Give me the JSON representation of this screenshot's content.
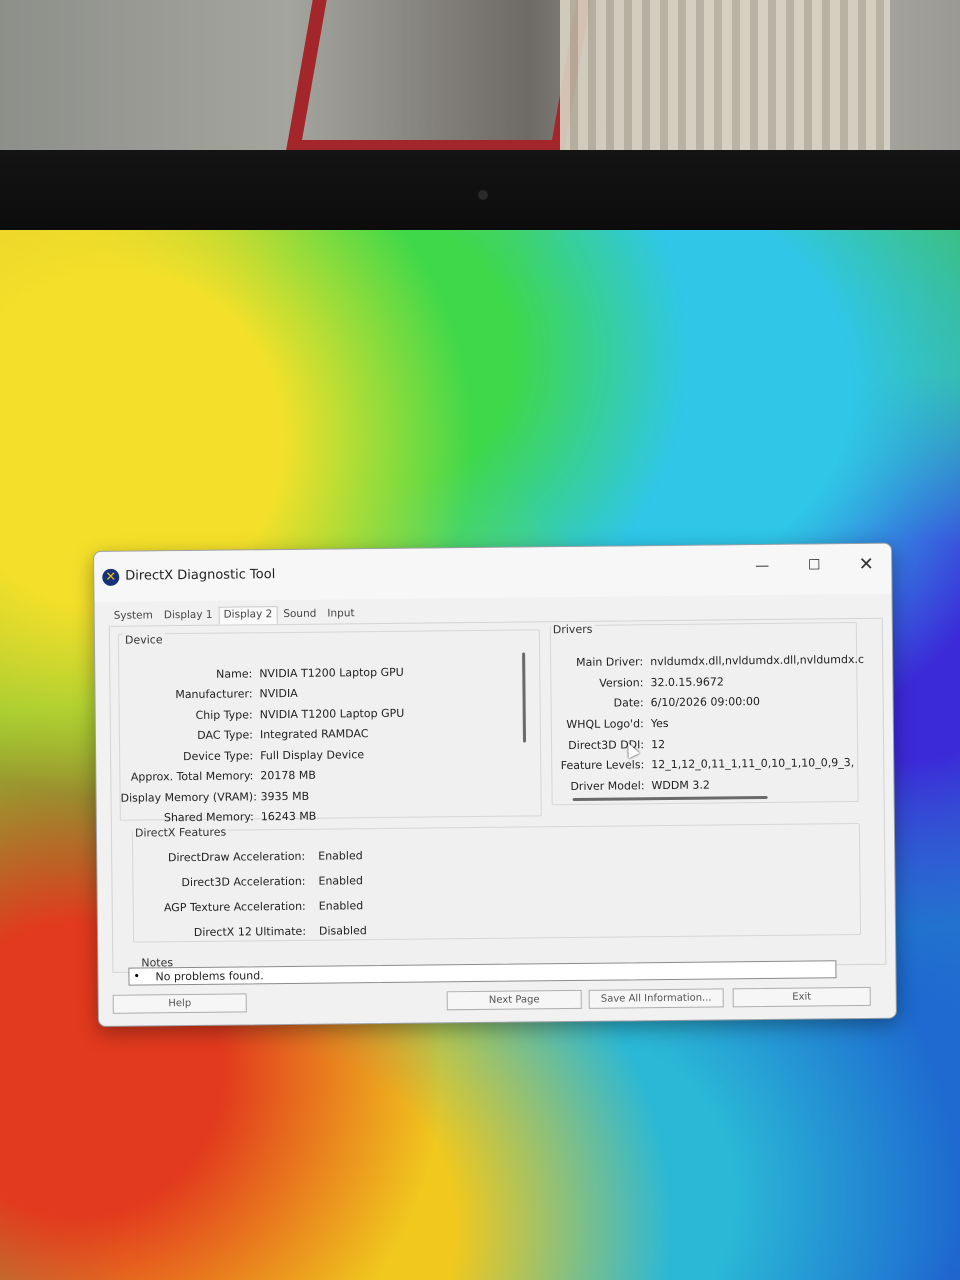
{
  "window": {
    "title": "DirectX Diagnostic Tool",
    "minimize_glyph": "—",
    "maximize_glyph": "☐",
    "close_glyph": "✕"
  },
  "tabs": [
    {
      "label": "System"
    },
    {
      "label": "Display 1"
    },
    {
      "label": "Display 2",
      "active": true
    },
    {
      "label": "Sound"
    },
    {
      "label": "Input"
    }
  ],
  "device": {
    "group_label": "Device",
    "rows": [
      {
        "label": "Name:",
        "value": "NVIDIA T1200 Laptop GPU"
      },
      {
        "label": "Manufacturer:",
        "value": "NVIDIA"
      },
      {
        "label": "Chip Type:",
        "value": "NVIDIA T1200 Laptop GPU"
      },
      {
        "label": "DAC Type:",
        "value": "Integrated RAMDAC"
      },
      {
        "label": "Device Type:",
        "value": "Full Display Device"
      },
      {
        "label": "Approx. Total Memory:",
        "value": "20178 MB"
      },
      {
        "label": "Display Memory (VRAM):",
        "value": "3935 MB"
      },
      {
        "label": "Shared Memory:",
        "value": "16243 MB"
      }
    ]
  },
  "drivers": {
    "group_label": "Drivers",
    "rows": [
      {
        "label": "Main Driver:",
        "value": "nvldumdx.dll,nvldumdx.dll,nvldumdx.c"
      },
      {
        "label": "Version:",
        "value": "32.0.15.9672"
      },
      {
        "label": "Date:",
        "value": "6/10/2026 09:00:00"
      },
      {
        "label": "WHQL Logo'd:",
        "value": "Yes"
      },
      {
        "label": "Direct3D DDI:",
        "value": "12"
      },
      {
        "label": "Feature Levels:",
        "value": "12_1,12_0,11_1,11_0,10_1,10_0,9_3,"
      },
      {
        "label": "Driver Model:",
        "value": "WDDM 3.2"
      }
    ]
  },
  "features": {
    "group_label": "DirectX Features",
    "rows": [
      {
        "label": "DirectDraw Acceleration:",
        "value": "Enabled"
      },
      {
        "label": "Direct3D Acceleration:",
        "value": "Enabled"
      },
      {
        "label": "AGP Texture Acceleration:",
        "value": "Enabled"
      },
      {
        "label": "DirectX 12 Ultimate:",
        "value": "Disabled"
      }
    ]
  },
  "notes": {
    "group_label": "Notes",
    "bullet": "•",
    "text": "No problems found."
  },
  "buttons": {
    "help": "Help",
    "next_page": "Next Page",
    "save_all": "Save All Information...",
    "exit": "Exit"
  }
}
